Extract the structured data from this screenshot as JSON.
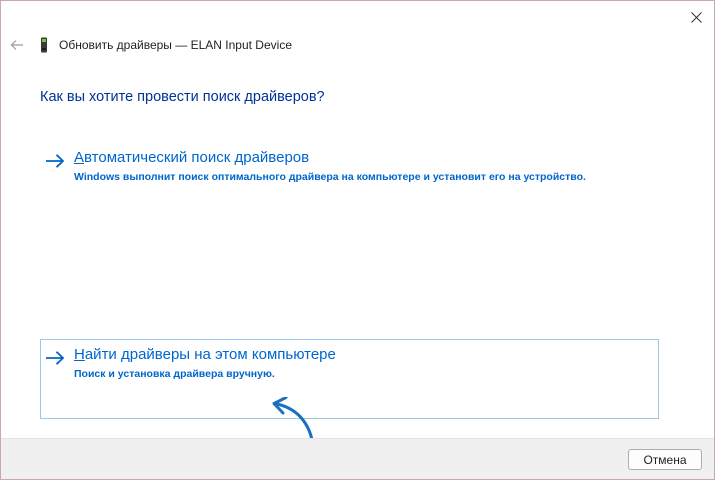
{
  "window": {
    "title": "Обновить драйверы — ELAN Input Device"
  },
  "page": {
    "question": "Как вы хотите провести поиск драйверов?"
  },
  "options": [
    {
      "title_accel": "А",
      "title_rest": "втоматический поиск драйверов",
      "description": "Windows выполнит поиск оптимального драйвера на компьютере и установит его на устройство."
    },
    {
      "title_accel": "Н",
      "title_rest": "айти драйверы на этом компьютере",
      "description": "Поиск и установка драйвера вручную."
    }
  ],
  "footer": {
    "cancel_label": "Отмена"
  },
  "icons": {
    "close": "close-icon",
    "back": "back-arrow-icon",
    "device": "device-icon",
    "option_arrow": "right-arrow-icon",
    "pointer": "curved-pointer-arrow-icon"
  },
  "colors": {
    "link": "#0066cc",
    "question": "#003399",
    "selected_border": "#99c9ea",
    "annotation_arrow": "#1a6fc0"
  }
}
